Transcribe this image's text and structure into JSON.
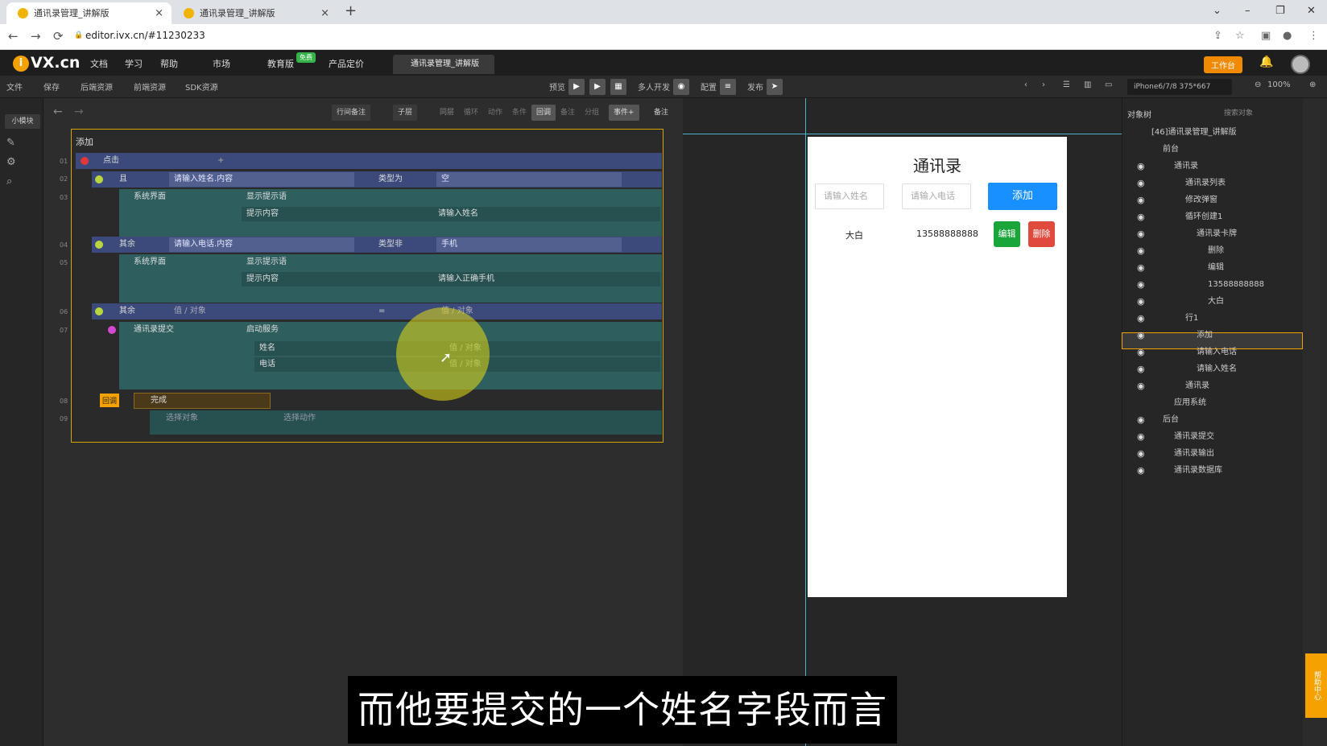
{
  "browser": {
    "tabs": [
      {
        "title": "通讯录管理_讲解版",
        "close": "×"
      },
      {
        "title": "通讯录管理_讲解版",
        "close": "×"
      }
    ],
    "new_tab": "+",
    "url": "editor.ivx.cn/#11230233",
    "back": "←",
    "forward": "→",
    "reload": "⟳",
    "lock": "🔒",
    "win_controls": {
      "menu": "⌄",
      "min": "–",
      "max": "❐",
      "close": "✕"
    }
  },
  "app": {
    "logo_mark": "i",
    "logo_text": "VX.cn",
    "menu": [
      "文档",
      "学习",
      "帮助",
      "市场",
      "教育版",
      "产品定价"
    ],
    "edu_badge": "免费",
    "project_tab": "通讯录管理_讲解版",
    "workbench": "工作台"
  },
  "toolbar": {
    "left": [
      "文件",
      "保存",
      "后端资源",
      "前端资源",
      "SDK资源"
    ],
    "center_labels": {
      "preview": "预览",
      "multi": "多人开发",
      "config": "配置",
      "publish": "发布"
    },
    "device": "iPhone6/7/8 375*667",
    "zoom": "100%"
  },
  "rail": {
    "module_tab": "小模块"
  },
  "logic": {
    "toolbar": [
      "行间备注",
      "子层",
      "同层",
      "循环",
      "动作",
      "条件",
      "回调",
      "备注",
      "分组",
      "事件+",
      "备注"
    ],
    "event_title": "添加",
    "rows": [
      {
        "n": "01",
        "a": "点击"
      },
      {
        "n": "02",
        "a": "且",
        "b": "请输入姓名.内容",
        "c": "类型为",
        "d": "空"
      },
      {
        "n": "03",
        "a": "系统界面",
        "b": "显示提示语",
        "c": "提示内容",
        "d": "请输入姓名"
      },
      {
        "n": "04",
        "a": "其余",
        "b": "请输入电话.内容",
        "c": "类型非",
        "d": "手机"
      },
      {
        "n": "05",
        "a": "系统界面",
        "b": "显示提示语",
        "c": "提示内容",
        "d": "请输入正确手机"
      },
      {
        "n": "06",
        "a": "其余",
        "b": "值 / 对象",
        "c": "=",
        "d": "值 / 对象"
      },
      {
        "n": "07",
        "a": "通讯录提交",
        "b": "启动服务",
        "c": "姓名",
        "c2": "电话",
        "d": "值 / 对象",
        "d2": "值 / 对象"
      },
      {
        "n": "08",
        "cb": "回调",
        "a": "完成"
      },
      {
        "n": "09",
        "a": "选择对象",
        "b": "选择动作"
      }
    ]
  },
  "phone": {
    "title": "通讯录",
    "name_placeholder": "请输入姓名",
    "phone_placeholder": "请输入电话",
    "add": "添加",
    "entry_name": "大白",
    "entry_phone": "13588888888",
    "edit": "编辑",
    "delete": "删除"
  },
  "objects": {
    "tabs": [
      "对象树",
      "搜索对象"
    ],
    "items": [
      {
        "label": "[46]通讯录管理_讲解版",
        "indent": 0
      },
      {
        "label": "前台",
        "indent": 1
      },
      {
        "label": "通讯录",
        "indent": 2
      },
      {
        "label": "通讯录列表",
        "indent": 3
      },
      {
        "label": "修改弹窗",
        "indent": 3
      },
      {
        "label": "循环创建1",
        "indent": 3
      },
      {
        "label": "通讯录卡牌",
        "indent": 4
      },
      {
        "label": "删除",
        "indent": 5
      },
      {
        "label": "编辑",
        "indent": 5
      },
      {
        "label": "13588888888",
        "indent": 5
      },
      {
        "label": "大白",
        "indent": 5
      },
      {
        "label": "行1",
        "indent": 3
      },
      {
        "label": "添加",
        "indent": 4
      },
      {
        "label": "请输入电话",
        "indent": 4
      },
      {
        "label": "请输入姓名",
        "indent": 4
      },
      {
        "label": "通讯录",
        "indent": 3
      },
      {
        "label": "应用系统",
        "indent": 2
      },
      {
        "label": "后台",
        "indent": 1
      },
      {
        "label": "通讯录提交",
        "indent": 2
      },
      {
        "label": "通讯录输出",
        "indent": 2
      },
      {
        "label": "通讯录数据库",
        "indent": 2
      }
    ],
    "help": "帮助中心"
  },
  "subtitle": "而他要提交的一个姓名字段而言",
  "colors": {
    "accent": "#f5a100",
    "add_button": "#1890ff",
    "edit_button": "#1aa53a",
    "delete_button": "#e04a3c",
    "guide": "#4fb2c6"
  }
}
